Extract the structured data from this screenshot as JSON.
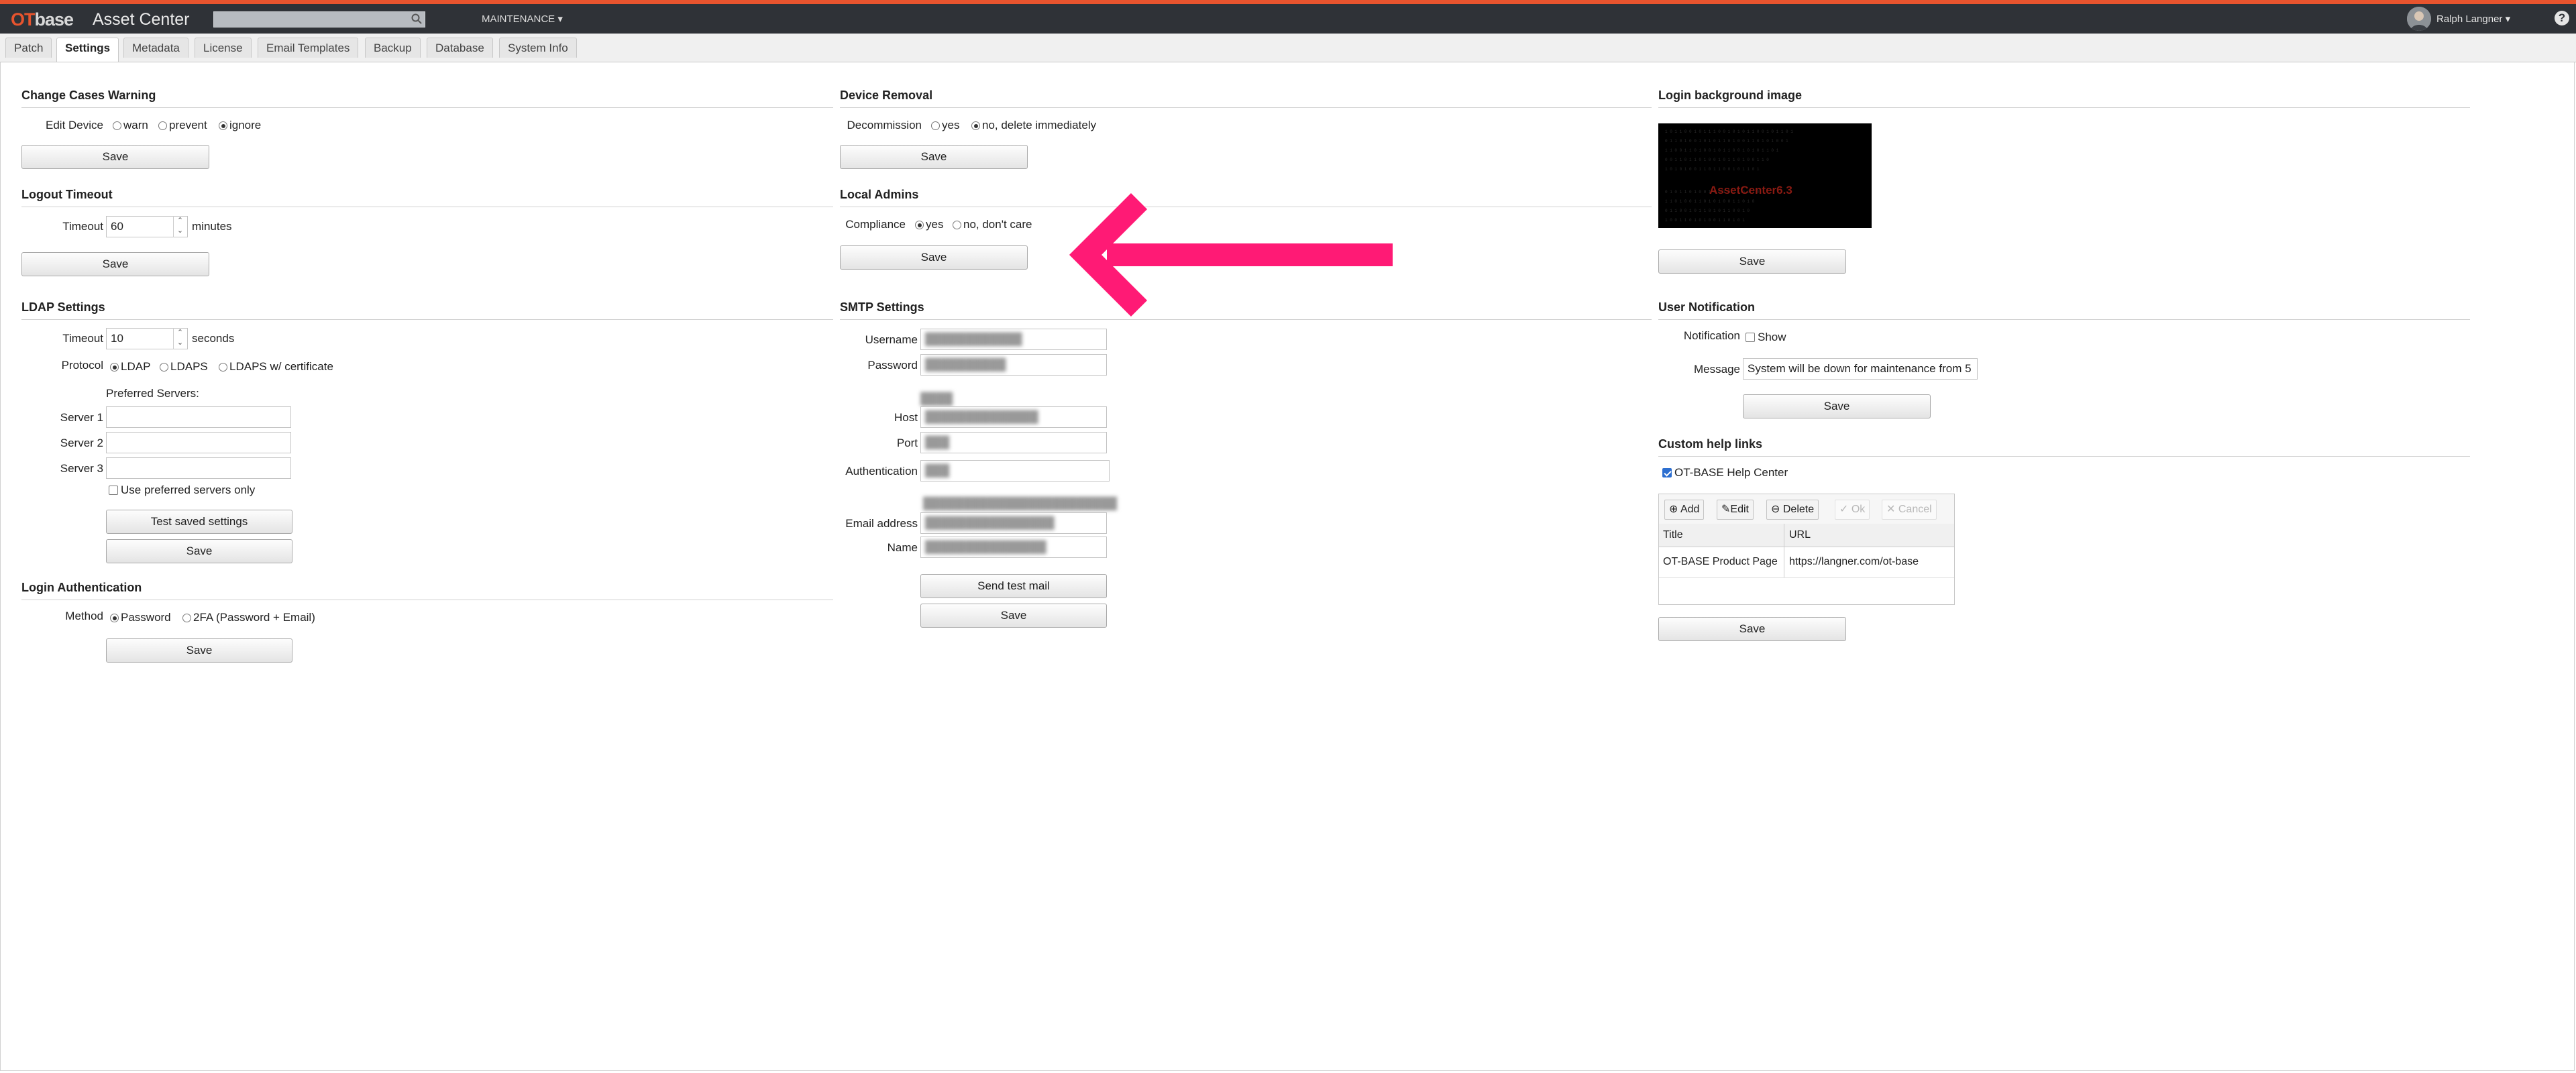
{
  "app": {
    "logo_ot": "OT",
    "logo_base": "base",
    "title": "Asset Center",
    "maintenance_menu": "MAINTENANCE ▾",
    "user": "Ralph Langner ▾",
    "help": "?"
  },
  "tabs": [
    "Patch",
    "Settings",
    "Metadata",
    "License",
    "Email Templates",
    "Backup",
    "Database",
    "System Info"
  ],
  "save": "Save",
  "change_cases": {
    "title": "Change Cases Warning",
    "label": "Edit Device",
    "options": [
      "warn",
      "prevent",
      "ignore"
    ]
  },
  "logout": {
    "title": "Logout Timeout",
    "label": "Timeout",
    "value": "60",
    "unit": "minutes"
  },
  "ldap": {
    "title": "LDAP Settings",
    "timeout_label": "Timeout",
    "timeout_value": "10",
    "timeout_unit": "seconds",
    "protocol_label": "Protocol",
    "protocols": [
      "LDAP",
      "LDAPS",
      "LDAPS w/ certificate"
    ],
    "preferred_label": "Preferred Servers:",
    "server1": "Server 1",
    "server2": "Server 2",
    "server3": "Server 3",
    "preferred_only": "Use preferred servers only",
    "test_button": "Test saved settings"
  },
  "login_auth": {
    "title": "Login Authentication",
    "label": "Method",
    "options": [
      "Password",
      "2FA (Password + Email)"
    ]
  },
  "device_removal": {
    "title": "Device Removal",
    "label": "Decommission",
    "options": [
      "yes",
      "no, delete immediately"
    ]
  },
  "local_admins": {
    "title": "Local Admins",
    "label": "Compliance",
    "options": [
      "yes",
      "no, don't care"
    ]
  },
  "smtp": {
    "title": "SMTP Settings",
    "username_label": "Username",
    "password_label": "Password",
    "host_label": "Host",
    "port_label": "Port",
    "auth_label": "Authentication",
    "email_label": "Email address",
    "name_label": "Name",
    "send_test": "Send test mail"
  },
  "login_bg": {
    "title": "Login background image",
    "image_text": "AssetCenter6.3"
  },
  "user_notification": {
    "title": "User Notification",
    "notification_label": "Notification",
    "show_label": "Show",
    "message_label": "Message",
    "message_value": "System will be down for maintenance from 5"
  },
  "help_links": {
    "title": "Custom help links",
    "checkbox_label": "OT-BASE Help Center",
    "toolbar": [
      "Add",
      "Edit",
      "Delete",
      "Ok",
      "Cancel"
    ],
    "columns": [
      "Title",
      "URL"
    ],
    "rows": [
      {
        "title": "OT-BASE Product Page",
        "url": "https://langner.com/ot-base"
      }
    ]
  },
  "colors": {
    "accent": "#e8542e",
    "topbar": "#2f3237",
    "arrow": "#ff1a75"
  }
}
